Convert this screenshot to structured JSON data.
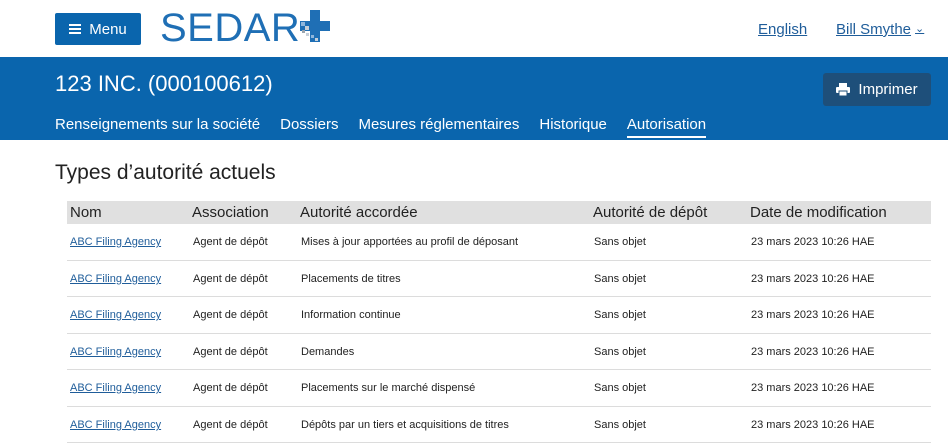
{
  "header": {
    "menu_label": "Menu",
    "logo_text": "SEDAR",
    "language_link": "English",
    "user_name": "Bill Smythe",
    "colors": {
      "brand_blue": "#0a65ad",
      "logo_blue": "#1f6fb5",
      "print_button": "#1e4f7a"
    }
  },
  "company": {
    "title": "123 INC. (000100612)",
    "print_label": "Imprimer"
  },
  "tabs": [
    {
      "label": "Renseignements sur la société",
      "active": false
    },
    {
      "label": "Dossiers",
      "active": false
    },
    {
      "label": "Mesures réglementaires",
      "active": false
    },
    {
      "label": "Historique",
      "active": false
    },
    {
      "label": "Autorisation",
      "active": true
    }
  ],
  "section": {
    "title": "Types d’autorité actuels"
  },
  "table": {
    "columns": [
      "Nom",
      "Association",
      "Autorité accordée",
      "Autorité de dépôt",
      "Date de modification"
    ],
    "rows": [
      [
        "ABC Filing Agency",
        "Agent de dépôt",
        "Mises à jour apportées au profil de déposant",
        "Sans objet",
        "23 mars 2023 10:26 HAE"
      ],
      [
        "ABC Filing Agency",
        "Agent de dépôt",
        "Placements de titres",
        "Sans objet",
        "23 mars 2023 10:26 HAE"
      ],
      [
        "ABC Filing Agency",
        "Agent de dépôt",
        "Information continue",
        "Sans objet",
        "23 mars 2023 10:26 HAE"
      ],
      [
        "ABC Filing Agency",
        "Agent de dépôt",
        "Demandes",
        "Sans objet",
        "23 mars 2023 10:26 HAE"
      ],
      [
        "ABC Filing Agency",
        "Agent de dépôt",
        "Placements sur le marché dispensé",
        "Sans objet",
        "23 mars 2023 10:26 HAE"
      ],
      [
        "ABC Filing Agency",
        "Agent de dépôt",
        "Dépôts par un tiers et acquisitions de titres",
        "Sans objet",
        "23 mars 2023 10:26 HAE"
      ]
    ]
  }
}
